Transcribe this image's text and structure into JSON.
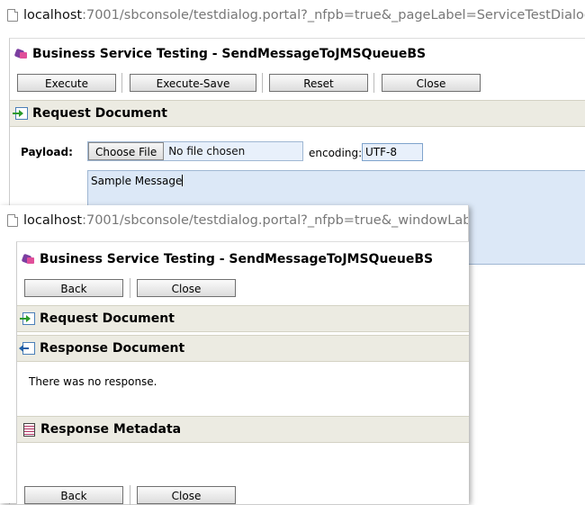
{
  "back_window": {
    "url_host": "localhost",
    "url_rest": ":7001/sbconsole/testdialog.portal?_nfpb=true&_pageLabel=ServiceTestDialogPag",
    "title": "Business Service Testing - SendMessageToJMSQueueBS",
    "buttons": {
      "execute": "Execute",
      "execute_save": "Execute-Save",
      "reset": "Reset",
      "close": "Close"
    },
    "request_section": "Request Document",
    "payload_label": "Payload:",
    "choose_file": "Choose File",
    "no_file": "No file chosen",
    "encoding_label": "encoding:",
    "encoding_value": "UTF-8",
    "payload_text": "Sample Message"
  },
  "front_window": {
    "url_host": "localhost",
    "url_rest": ":7001/sbconsole/testdialog.portal?_nfpb=true&_windowLabe",
    "title": "Business Service Testing - SendMessageToJMSQueueBS",
    "buttons": {
      "back": "Back",
      "close": "Close"
    },
    "request_section": "Request Document",
    "response_section": "Response Document",
    "response_text": "There was no response.",
    "metadata_section": "Response Metadata",
    "bottom_buttons": {
      "back": "Back",
      "close": "Close"
    }
  },
  "icons": {
    "page": "page-icon",
    "service": "business-service-icon",
    "request": "request-document-icon",
    "response": "response-document-icon",
    "metadata": "response-metadata-icon"
  }
}
